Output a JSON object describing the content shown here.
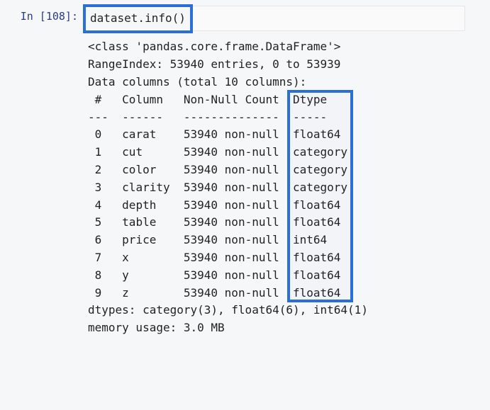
{
  "prompt": {
    "label": "In [108]:"
  },
  "code": {
    "source": "dataset.info()"
  },
  "output": {
    "class_line": "<class 'pandas.core.frame.DataFrame'>",
    "range_index": "RangeIndex: 53940 entries, 0 to 53939",
    "data_columns_header": "Data columns (total 10 columns):",
    "header": {
      "idx": " # ",
      "column": "Column ",
      "nonnull": "Non-Null Count",
      "dtype": "Dtype   "
    },
    "sep": {
      "idx": "---",
      "column": "------ ",
      "nonnull": "--------------",
      "dtype": "-----   "
    },
    "rows": [
      {
        "idx": " 0 ",
        "column": "carat  ",
        "nonnull": "53940 non-null",
        "dtype": "float64 "
      },
      {
        "idx": " 1 ",
        "column": "cut    ",
        "nonnull": "53940 non-null",
        "dtype": "category"
      },
      {
        "idx": " 2 ",
        "column": "color  ",
        "nonnull": "53940 non-null",
        "dtype": "category"
      },
      {
        "idx": " 3 ",
        "column": "clarity",
        "nonnull": "53940 non-null",
        "dtype": "category"
      },
      {
        "idx": " 4 ",
        "column": "depth  ",
        "nonnull": "53940 non-null",
        "dtype": "float64 "
      },
      {
        "idx": " 5 ",
        "column": "table  ",
        "nonnull": "53940 non-null",
        "dtype": "float64 "
      },
      {
        "idx": " 6 ",
        "column": "price  ",
        "nonnull": "53940 non-null",
        "dtype": "int64   "
      },
      {
        "idx": " 7 ",
        "column": "x      ",
        "nonnull": "53940 non-null",
        "dtype": "float64 "
      },
      {
        "idx": " 8 ",
        "column": "y      ",
        "nonnull": "53940 non-null",
        "dtype": "float64 "
      },
      {
        "idx": " 9 ",
        "column": "z      ",
        "nonnull": "53940 non-null",
        "dtype": "float64 "
      }
    ],
    "dtypes_summary": "dtypes: category(3), float64(6), int64(1)",
    "memory_usage": "memory usage: 3.0 MB"
  },
  "annotations": {
    "highlight_1": {
      "purpose": "code-expression-highlight"
    },
    "highlight_2": {
      "purpose": "dtype-column-highlight"
    }
  }
}
